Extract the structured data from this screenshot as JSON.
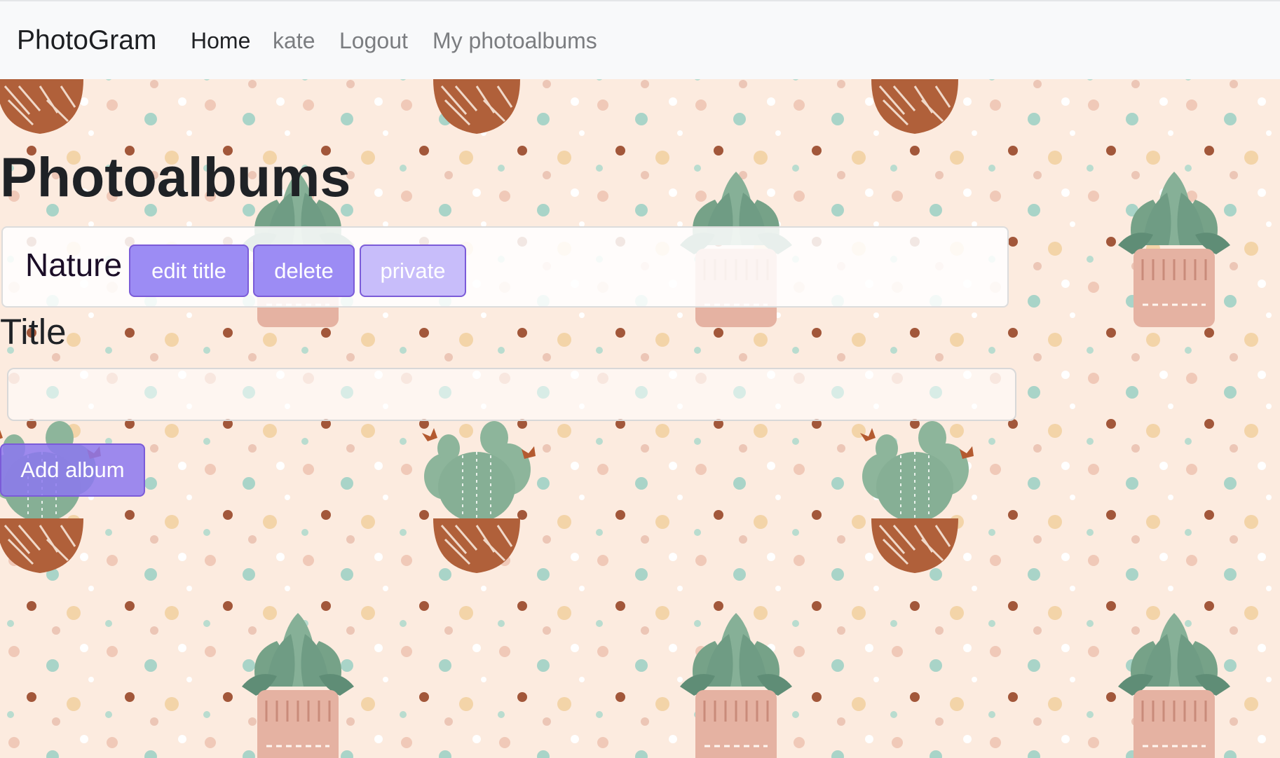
{
  "navbar": {
    "brand": "PhotoGram",
    "links": [
      {
        "label": "Home",
        "active": true
      },
      {
        "label": "kate",
        "active": false
      },
      {
        "label": "Logout",
        "active": false
      },
      {
        "label": "My photoalbums",
        "active": false
      }
    ]
  },
  "main": {
    "title": "Photoalbums",
    "albums": [
      {
        "name": "Nature",
        "edit_label": "edit title",
        "delete_label": "delete",
        "visibility_label": "private"
      }
    ],
    "form": {
      "title_label": "Title",
      "title_value": "",
      "submit_label": "Add album"
    }
  },
  "theme": {
    "background": "#fcebdf",
    "button_color": "#9c8cf4",
    "private_button_color": "#c8bdfa",
    "navbar_color": "#f8f9fa"
  }
}
